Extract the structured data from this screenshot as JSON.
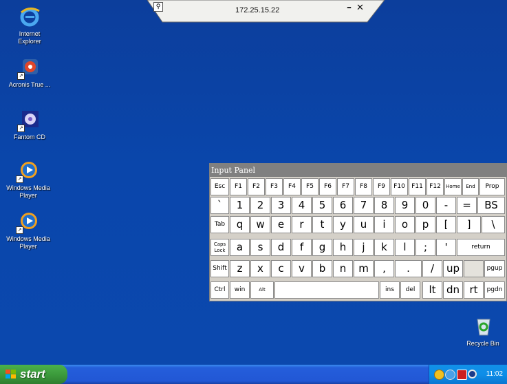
{
  "rdp_bar": {
    "title": "172.25.15.22",
    "minimize": "–",
    "close": "✕"
  },
  "desktop_icons": [
    {
      "label": "Internet\nExplorer",
      "icon": "internet-explorer-icon"
    },
    {
      "label": "Acronis True ...",
      "icon": "acronis-icon"
    },
    {
      "label": "Fantom CD",
      "icon": "fantom-cd-icon"
    },
    {
      "label": "Windows Media\nPlayer",
      "icon": "windows-media-player-icon"
    },
    {
      "label": "Windows Media\nPlayer",
      "icon": "windows-media-player-icon"
    },
    {
      "label": "Recycle Bin",
      "icon": "recycle-bin-icon"
    }
  ],
  "input_panel": {
    "title": "Input Panel",
    "rows": [
      [
        "Esc",
        "F1",
        "F2",
        "F3",
        "F4",
        "F5",
        "F6",
        "F7",
        "F8",
        "F9",
        "F10",
        "F11",
        "F12",
        "Home",
        "End",
        "Prop"
      ],
      [
        "`",
        "1",
        "2",
        "3",
        "4",
        "5",
        "6",
        "7",
        "8",
        "9",
        "0",
        "-",
        "=",
        "BS"
      ],
      [
        "Tab",
        "q",
        "w",
        "e",
        "r",
        "t",
        "y",
        "u",
        "i",
        "o",
        "p",
        "[",
        "]",
        "\\"
      ],
      [
        "Caps Lock",
        "a",
        "s",
        "d",
        "f",
        "g",
        "h",
        "j",
        "k",
        "l",
        ";",
        "'",
        "return"
      ],
      [
        "Shift",
        "z",
        "x",
        "c",
        "v",
        "b",
        "n",
        "m",
        ",",
        ".",
        "/",
        "up",
        "",
        "pgup"
      ],
      [
        "Ctrl",
        "win",
        "Alt",
        "",
        "ins",
        "del",
        "lt",
        "dn",
        "rt",
        "pgdn"
      ]
    ]
  },
  "taskbar": {
    "start_label": "start",
    "clock": "11:02",
    "tray_icons": [
      "network-icon",
      "messenger-icon",
      "security-shield-icon",
      "volume-icon"
    ]
  },
  "colors": {
    "desktop": "#0a44a8",
    "taskbar": "#245edb",
    "start": "#3c9b3c",
    "tray": "#0d8ee8"
  }
}
